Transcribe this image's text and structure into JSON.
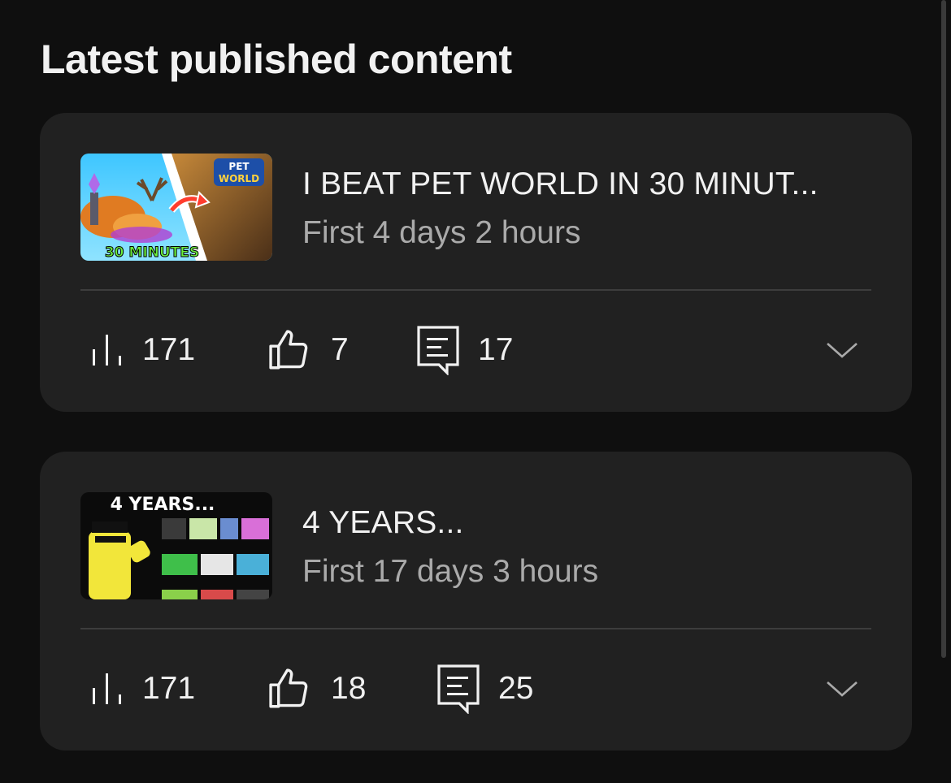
{
  "section": {
    "title": "Latest published content"
  },
  "items": [
    {
      "title": "I BEAT PET WORLD IN 30 MINUT...",
      "subtitle": "First 4 days 2 hours",
      "thumbnail": {
        "badge_top": "PET",
        "badge_bottom": "WORLD",
        "caption": "30 MINUTES"
      },
      "views": "171",
      "likes": "7",
      "comments": "17"
    },
    {
      "title": "4 YEARS...",
      "subtitle": "First 17 days 3 hours",
      "thumbnail": {
        "caption": "4 YEARS..."
      },
      "views": "171",
      "likes": "18",
      "comments": "25"
    }
  ],
  "icons": {
    "views": "bar-chart-icon",
    "likes": "thumbs-up-icon",
    "comments": "comment-icon",
    "expand": "chevron-down-icon"
  },
  "colors": {
    "background": "#0f0f0f",
    "card": "#212121",
    "text_primary": "#f1f1f1",
    "text_secondary": "#aaaaaa",
    "divider": "#3d3d3d"
  }
}
